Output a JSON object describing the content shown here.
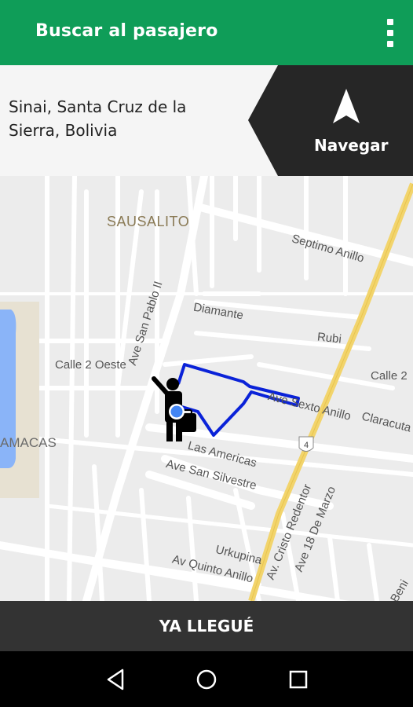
{
  "appbar": {
    "title": "Buscar al pasajero",
    "menu_icon": "overflow-menu-icon"
  },
  "address": {
    "line1": "Sinai, Santa Cruz de la",
    "line2": "Sierra, Bolivia"
  },
  "navigate": {
    "label": "Navegar",
    "icon": "navigation-arrow-icon"
  },
  "map": {
    "labels": {
      "sausalito": "SAUSALITO",
      "septimo": "Septimo Anillo",
      "diamante": "Diamante",
      "rubi": "Rubi",
      "calle2oeste": "Calle 2 Oeste",
      "calle2": "Calle 2",
      "avsanpablo": "Ave San Pablo II",
      "avsexto": "Ave Sexto Anillo",
      "claracuta": "Claracuta",
      "amacas": "AMACAS",
      "lasamericas": "Las Americas",
      "avsansilvestre": "Ave San Silvestre",
      "avcristo": "Av. Cristo Redentor",
      "ave18": "Ave 18 De Marzo",
      "urkupina": "Urkupina",
      "avquinto": "Av Quinto Anillo",
      "beni": "Beni",
      "route_shield": "4"
    },
    "colors": {
      "route": "#0a22d8",
      "highway": "#f2d46c",
      "water": "#8ab4f8"
    }
  },
  "bottom_button": {
    "label": "YA LLEGUÉ"
  },
  "system_nav": {
    "back": "back-icon",
    "home": "home-icon",
    "recents": "recents-icon"
  }
}
